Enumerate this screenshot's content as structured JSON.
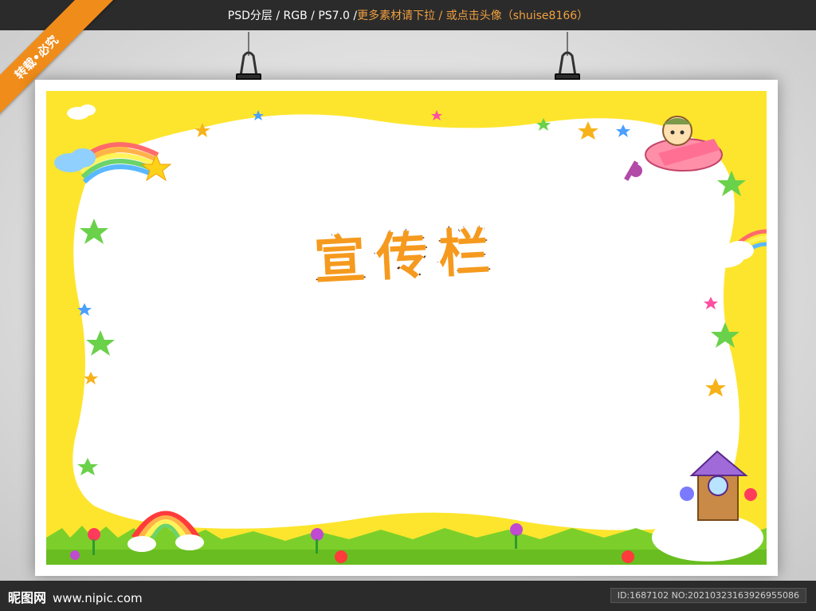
{
  "top_bar": {
    "format_text": "PSD分层 / RGB / PS7.0 / ",
    "more_text": "更多素材请下拉 / 或点击头像（shuise8166）"
  },
  "ribbon": {
    "label": "转载•必究"
  },
  "poster": {
    "title": "宣传栏",
    "colors": {
      "frame_yellow": "#fde52e",
      "grass_green": "#7ccf2a",
      "title_orange": "#f59a1e",
      "title_outline": "#5a2a10"
    }
  },
  "bottom_bar": {
    "logo_text": "昵图网",
    "site_url": "www.nipic.com",
    "id_text": "ID:1687102 NO:20210323163926955086"
  }
}
